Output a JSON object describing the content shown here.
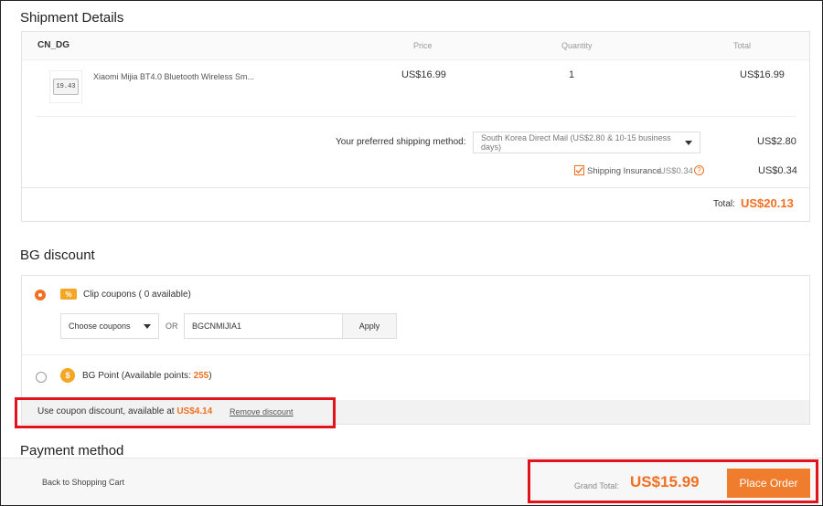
{
  "shipment": {
    "title": "Shipment Details",
    "warehouse": "CN_DG",
    "columns": {
      "price": "Price",
      "quantity": "Quantity",
      "total": "Total"
    },
    "item": {
      "name": "Xiaomi Mijia BT4.0 Bluetooth Wireless Sm...",
      "thumb_text": "19.43",
      "price": "US$16.99",
      "quantity": "1",
      "total": "US$16.99"
    },
    "shipping_method_label": "Your preferred shipping method:",
    "shipping_method_value": "South Korea Direct Mail (US$2.80 & 10-15 business days)",
    "shipping_cost": "US$2.80",
    "insurance_label": "Shipping Insurance",
    "insurance_price": "US$0.34",
    "insurance_cost": "US$0.34",
    "total_label": "Total:",
    "total_value": "US$20.13"
  },
  "discount": {
    "title": "BG discount",
    "clip_badge": "%",
    "clip_label": "Clip coupons ( 0 available)",
    "choose_placeholder": "Choose coupons",
    "or_label": "OR",
    "coupon_code": "BGCNMIJIA1",
    "apply_label": "Apply",
    "bg_point_label": "BG Point (Available points: ",
    "bg_point_value": "255",
    "bg_point_close": ")",
    "bg_point_coin": "$",
    "coupon_note_prefix": "Use coupon discount, available at ",
    "coupon_note_value": "US$4.14",
    "remove_label": "Remove discount"
  },
  "payment": {
    "title": "Payment method"
  },
  "footer": {
    "back_label": "Back to Shopping Cart",
    "grand_total_label": "Grand Total:",
    "grand_total_value": "US$15.99",
    "place_order_label": "Place Order"
  },
  "colors": {
    "accent": "#f26f21",
    "button": "#f07d2d",
    "highlight_box": "#e0141a"
  }
}
